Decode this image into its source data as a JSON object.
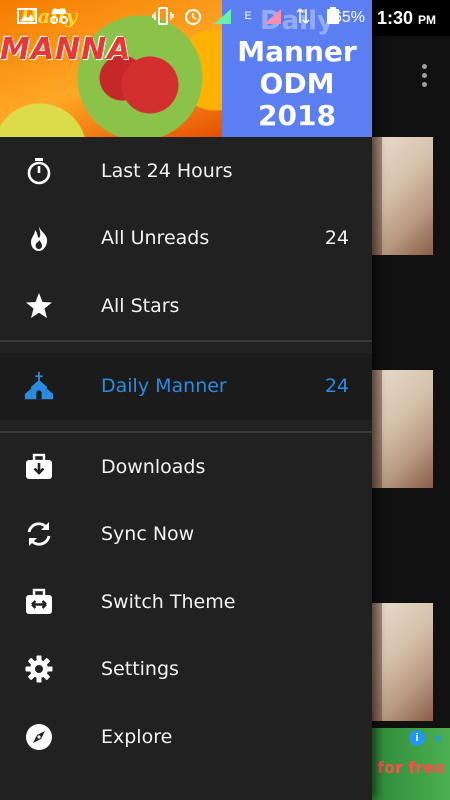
{
  "status_bar": {
    "battery_percent": "65%",
    "time": "1:30",
    "time_suffix": "PM",
    "network": "E"
  },
  "header": {
    "art_text_top": "Daily",
    "art_text_main": "MANNA",
    "title_faded": "Daily",
    "title_line1": "Manner",
    "title_line2": "ODM",
    "title_line3": "2018"
  },
  "menu": {
    "items": [
      {
        "label": "Last 24 Hours",
        "icon": "stopwatch-icon",
        "count": ""
      },
      {
        "label": "All Unreads",
        "icon": "flame-icon",
        "count": "24"
      },
      {
        "label": "All Stars",
        "icon": "star-icon",
        "count": ""
      }
    ],
    "feed": {
      "label": "Daily Manner",
      "icon": "church-icon",
      "count": "24"
    },
    "actions": [
      {
        "label": "Downloads",
        "icon": "download-briefcase-icon"
      },
      {
        "label": "Sync Now",
        "icon": "sync-icon"
      },
      {
        "label": "Switch Theme",
        "icon": "switch-theme-icon"
      },
      {
        "label": "Settings",
        "icon": "gear-icon"
      },
      {
        "label": "Explore",
        "icon": "compass-icon"
      }
    ]
  },
  "ad": {
    "text": "for free",
    "info": "i",
    "close": "×"
  },
  "colors": {
    "drawer_bg": "#212121",
    "accent": "#2b8be0",
    "header_blue": "#5b7ff2"
  }
}
